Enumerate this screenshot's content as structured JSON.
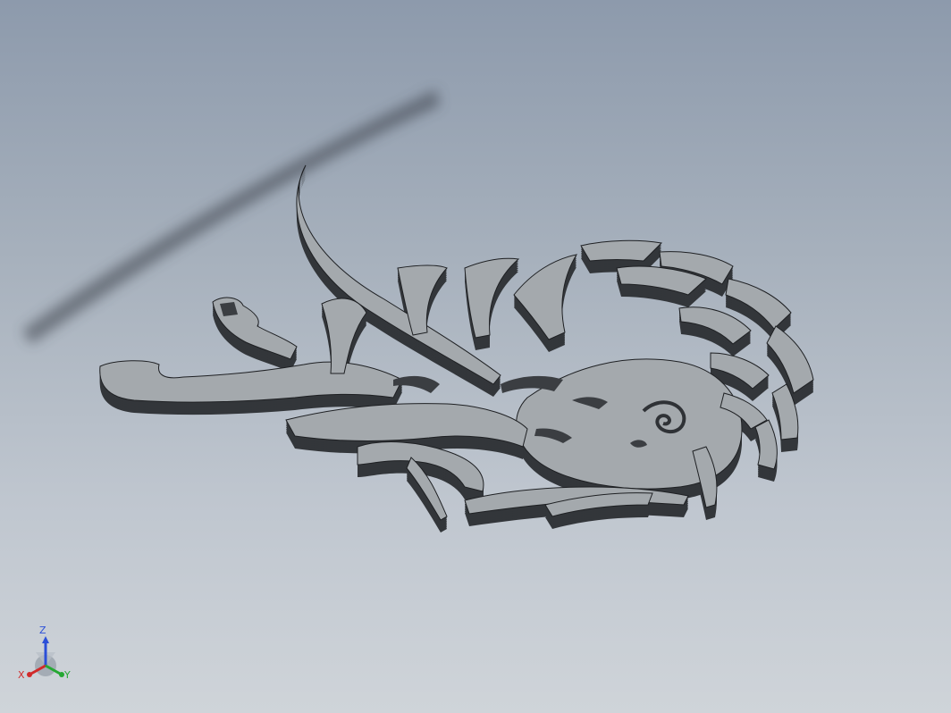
{
  "viewport": {
    "bg_top": "#8d9aac",
    "bg_bottom": "#cfd4d9",
    "part_face_color": "#a4a9ad",
    "part_wall_color": "#3b3e42",
    "part_edge_color": "#1e2023"
  },
  "triad": {
    "z_label": "Z",
    "x_label": "X",
    "y_label": "Y",
    "z_color": "#2b4fd8",
    "x_color": "#d12a2a",
    "y_color": "#25a833"
  }
}
